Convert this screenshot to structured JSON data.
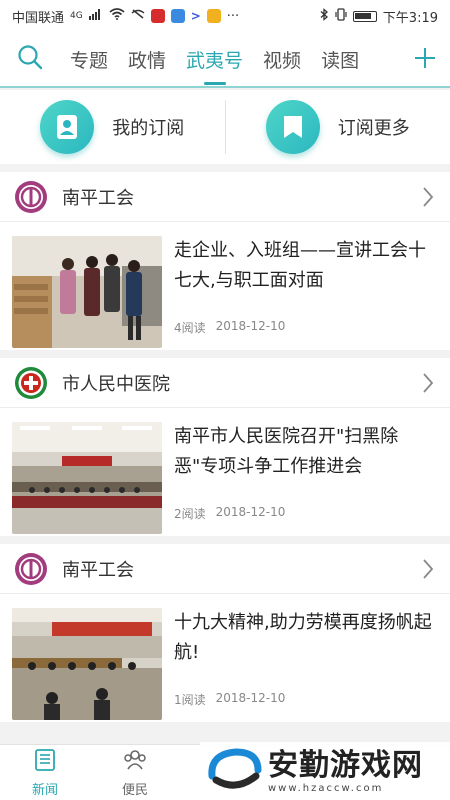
{
  "status_bar": {
    "carrier": "中国联通",
    "network": "4G",
    "time": "下午3:19",
    "more": "···"
  },
  "tabs": [
    {
      "label": "专题",
      "active": false
    },
    {
      "label": "政情",
      "active": false
    },
    {
      "label": "武夷号",
      "active": true
    },
    {
      "label": "视频",
      "active": false
    },
    {
      "label": "读图",
      "active": false
    }
  ],
  "icons": {
    "search": "search-icon",
    "add": "plus-icon",
    "my_sub": "user-icon",
    "more_sub": "bookmark-icon",
    "chevron": "chevron-right-icon"
  },
  "subscriptions": {
    "my": "我的订阅",
    "more": "订阅更多"
  },
  "channels": [
    {
      "name": "南平工会",
      "article": {
        "title": "走企业、入班组——宣讲工会十七大,与职工面对面",
        "reads": "4阅读",
        "date": "2018-12-10"
      }
    },
    {
      "name": "市人民中医院",
      "article": {
        "title": "南平市人民医院召开\"扫黑除恶\"专项斗争工作推进会",
        "reads": "2阅读",
        "date": "2018-12-10"
      }
    },
    {
      "name": "南平工会",
      "article": {
        "title": "十九大精神,助力劳模再度扬帆起航!",
        "reads": "1阅读",
        "date": "2018-12-10"
      }
    }
  ],
  "bottom_nav": [
    {
      "label": "新闻",
      "active": true
    },
    {
      "label": "便民",
      "active": false
    }
  ],
  "watermark": {
    "title": "安勤游戏网",
    "url": "www.hzaccw.com"
  },
  "colors": {
    "accent": "#2aa7b0",
    "union_logo": "#a23c7e",
    "hospital_logo": "#c8281e"
  }
}
